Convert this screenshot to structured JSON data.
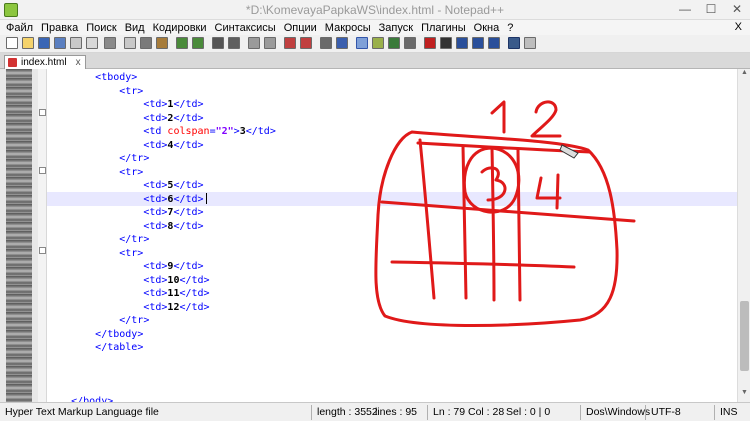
{
  "window": {
    "title": "*D:\\KomevayaPapkaWS\\index.html - Notepad++",
    "minimize": "—",
    "maximize": "☐",
    "close": "✕"
  },
  "menu": [
    "Файл",
    "Правка",
    "Поиск",
    "Вид",
    "Кодировки",
    "Синтаксисы",
    "Опции",
    "Макросы",
    "Запуск",
    "Плагины",
    "Окна",
    "?"
  ],
  "menu_close": "X",
  "tab": {
    "label": "index.html",
    "close": "x"
  },
  "code_lines": [
    [
      {
        "c": "t",
        "v": "<tbody>"
      }
    ],
    [
      {
        "c": "t",
        "v": "<tr>"
      }
    ],
    [
      {
        "c": "t",
        "v": "<td>"
      },
      {
        "c": "n",
        "v": "1"
      },
      {
        "c": "t",
        "v": "</td>"
      }
    ],
    [
      {
        "c": "t",
        "v": "<td>"
      },
      {
        "c": "n",
        "v": "2"
      },
      {
        "c": "t",
        "v": "</td>"
      }
    ],
    [
      {
        "c": "t",
        "v": "<td "
      },
      {
        "c": "a",
        "v": "colspan"
      },
      {
        "c": "t",
        "v": "="
      },
      {
        "c": "s",
        "v": "\"2\""
      },
      {
        "c": "t",
        "v": ">"
      },
      {
        "c": "n",
        "v": "3"
      },
      {
        "c": "t",
        "v": "</td>"
      }
    ],
    [
      {
        "c": "t",
        "v": "<td>"
      },
      {
        "c": "n",
        "v": "4"
      },
      {
        "c": "t",
        "v": "</td>"
      }
    ],
    [
      {
        "c": "t",
        "v": "</tr>"
      }
    ],
    [
      {
        "c": "t",
        "v": "<tr>"
      }
    ],
    [
      {
        "c": "t",
        "v": "<td>"
      },
      {
        "c": "n",
        "v": "5"
      },
      {
        "c": "t",
        "v": "</td>"
      }
    ],
    [
      {
        "c": "t",
        "v": "<td>"
      },
      {
        "c": "n",
        "v": "6"
      },
      {
        "c": "t",
        "v": "</td>"
      }
    ],
    [
      {
        "c": "t",
        "v": "<td>"
      },
      {
        "c": "n",
        "v": "7"
      },
      {
        "c": "t",
        "v": "</td>"
      }
    ],
    [
      {
        "c": "t",
        "v": "<td>"
      },
      {
        "c": "n",
        "v": "8"
      },
      {
        "c": "t",
        "v": "</td>"
      }
    ],
    [
      {
        "c": "t",
        "v": "</tr>"
      }
    ],
    [
      {
        "c": "t",
        "v": "<tr>"
      }
    ],
    [
      {
        "c": "t",
        "v": "<td>"
      },
      {
        "c": "n",
        "v": "9"
      },
      {
        "c": "t",
        "v": "</td>"
      }
    ],
    [
      {
        "c": "t",
        "v": "<td>"
      },
      {
        "c": "n",
        "v": "10"
      },
      {
        "c": "t",
        "v": "</td>"
      }
    ],
    [
      {
        "c": "t",
        "v": "<td>"
      },
      {
        "c": "n",
        "v": "11"
      },
      {
        "c": "t",
        "v": "</td>"
      }
    ],
    [
      {
        "c": "t",
        "v": "<td>"
      },
      {
        "c": "n",
        "v": "12"
      },
      {
        "c": "t",
        "v": "</td>"
      }
    ],
    [
      {
        "c": "t",
        "v": "</tr>"
      }
    ],
    [
      {
        "c": "t",
        "v": "</tbody>"
      }
    ],
    [
      {
        "c": "t",
        "v": "</table>"
      }
    ],
    [],
    [],
    [],
    [
      {
        "c": "t",
        "v": "</body>"
      }
    ]
  ],
  "code_indents": [
    2,
    3,
    4,
    4,
    4,
    4,
    3,
    3,
    4,
    4,
    4,
    4,
    3,
    3,
    4,
    4,
    4,
    4,
    3,
    2,
    2,
    0,
    0,
    0,
    1
  ],
  "status": {
    "file_type": "Hyper Text Markup Language file",
    "length": "length : 3552",
    "lines": "lines : 95",
    "ln": "Ln : 79",
    "col": "Col : 28",
    "sel": "Sel : 0 | 0",
    "eol": "Dos\\Windows",
    "encoding": "UTF-8",
    "mode": "INS"
  },
  "annotation": {
    "color": "#e01919",
    "labels": [
      "1",
      "2",
      "3",
      "4"
    ]
  }
}
